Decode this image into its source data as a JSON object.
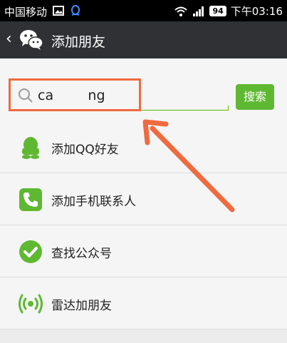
{
  "statusbar": {
    "carrier": "中国移动",
    "battery": "94",
    "time": "下午03:16"
  },
  "titlebar": {
    "back": "‹",
    "title": "添加朋友"
  },
  "search": {
    "value": "ca        ng",
    "button_label": "搜索"
  },
  "list": [
    {
      "label": "添加QQ好友",
      "icon": "qq-penguin-icon"
    },
    {
      "label": "添加手机联系人",
      "icon": "phone-icon"
    },
    {
      "label": "查找公众号",
      "icon": "check-circle-icon"
    },
    {
      "label": "雷达加朋友",
      "icon": "radar-icon"
    }
  ],
  "colors": {
    "accent": "#5fb832",
    "highlight": "#ef6b3f",
    "titlebar": "#2f3134"
  }
}
